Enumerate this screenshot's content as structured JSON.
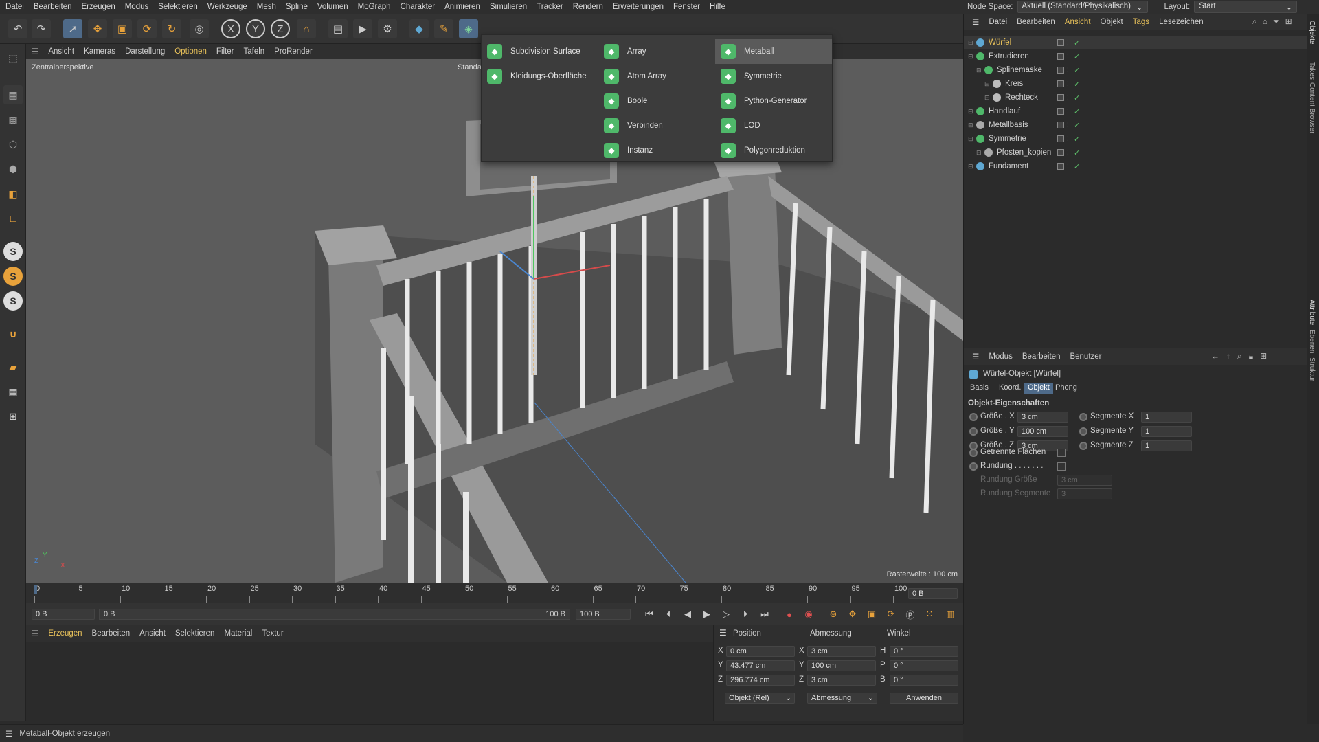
{
  "menubar": [
    "Datei",
    "Bearbeiten",
    "Erzeugen",
    "Modus",
    "Selektieren",
    "Werkzeuge",
    "Mesh",
    "Spline",
    "Volumen",
    "MoGraph",
    "Charakter",
    "Animieren",
    "Simulieren",
    "Tracker",
    "Rendern",
    "Erweiterungen",
    "Fenster",
    "Hilfe"
  ],
  "nodespace": {
    "label": "Node Space:",
    "value": "Aktuell (Standard/Physikalisch)",
    "layout_label": "Layout:",
    "layout_value": "Start"
  },
  "viewport_menu": [
    "Ansicht",
    "Kameras",
    "Darstellung",
    "Optionen",
    "Filter",
    "Tafeln",
    "ProRender"
  ],
  "viewport": {
    "title": "Zentralperspektive",
    "raster": "Rasterweite : 100 cm",
    "stand": "Standa"
  },
  "dropmenu": {
    "col1": [
      {
        "label": "Subdivision Surface",
        "color": "#4fb86a"
      },
      {
        "label": "Kleidungs-Oberfläche",
        "color": "#4fb86a"
      }
    ],
    "col2": [
      {
        "label": "Array",
        "color": "#4fb86a"
      },
      {
        "label": "Atom Array",
        "color": "#4fb86a"
      },
      {
        "label": "Boole",
        "color": "#4fb86a"
      },
      {
        "label": "Verbinden",
        "color": "#4fb86a"
      },
      {
        "label": "Instanz",
        "color": "#4fb86a"
      }
    ],
    "col3": [
      {
        "label": "Metaball",
        "color": "#4fb86a"
      },
      {
        "label": "Symmetrie",
        "color": "#4fb86a"
      },
      {
        "label": "Python-Generator",
        "color": "#4fb86a"
      },
      {
        "label": "LOD",
        "color": "#4fb86a"
      },
      {
        "label": "Polygonreduktion",
        "color": "#4fb86a"
      }
    ]
  },
  "timeline": {
    "ticks": [
      "0",
      "5",
      "10",
      "15",
      "20",
      "25",
      "30",
      "35",
      "40",
      "45",
      "50",
      "55",
      "60",
      "65",
      "70",
      "75",
      "80",
      "85",
      "90",
      "95",
      "100"
    ],
    "frame_right": "0 B"
  },
  "playbar": {
    "start": "0 B",
    "range_start": "0 B",
    "range_end": "100 B",
    "end": "100 B"
  },
  "material_menu": [
    "Erzeugen",
    "Bearbeiten",
    "Ansicht",
    "Selektieren",
    "Material",
    "Textur"
  ],
  "coords": {
    "headers": [
      "Position",
      "Abmessung",
      "Winkel"
    ],
    "rows": [
      {
        "axis": "X",
        "pos": "0 cm",
        "dimaxis": "X",
        "dim": "3 cm",
        "angaxis": "H",
        "ang": "0 °"
      },
      {
        "axis": "Y",
        "pos": "43.477 cm",
        "dimaxis": "Y",
        "dim": "100 cm",
        "angaxis": "P",
        "ang": "0 °"
      },
      {
        "axis": "Z",
        "pos": "296.774 cm",
        "dimaxis": "Z",
        "dim": "3 cm",
        "angaxis": "B",
        "ang": "0 °"
      }
    ],
    "mode": "Objekt (Rel)",
    "size": "Abmessung",
    "apply": "Anwenden"
  },
  "status": "Metaball-Objekt erzeugen",
  "objmenu": [
    "Datei",
    "Bearbeiten",
    "Ansicht",
    "Objekt",
    "Tags",
    "Lesezeichen"
  ],
  "objects": [
    {
      "name": "Würfel",
      "indent": 0,
      "color": "#5fa8d3",
      "active": true
    },
    {
      "name": "Extrudieren",
      "indent": 0,
      "color": "#4fb86a"
    },
    {
      "name": "Splinemaske",
      "indent": 1,
      "color": "#4fb86a"
    },
    {
      "name": "Kreis",
      "indent": 2,
      "color": "#bbbbbb"
    },
    {
      "name": "Rechteck",
      "indent": 2,
      "color": "#bbbbbb"
    },
    {
      "name": "Handlauf",
      "indent": 0,
      "color": "#4fb86a"
    },
    {
      "name": "Metallbasis",
      "indent": 0,
      "color": "#aaaaaa"
    },
    {
      "name": "Symmetrie",
      "indent": 0,
      "color": "#4fb86a"
    },
    {
      "name": "Pfosten_kopien",
      "indent": 1,
      "color": "#aaaaaa"
    },
    {
      "name": "Fundament",
      "indent": 0,
      "color": "#5fa8d3"
    }
  ],
  "attr": {
    "menu": [
      "Modus",
      "Bearbeiten",
      "Benutzer"
    ],
    "title": "Würfel-Objekt [Würfel]",
    "tabs": [
      "Basis",
      "Koord.",
      "Objekt",
      "Phong"
    ],
    "section": "Objekt-Eigenschaften",
    "size_rows": [
      {
        "label": "Größe . X",
        "value": "3 cm",
        "seg_label": "Segmente X",
        "seg": "1"
      },
      {
        "label": "Größe . Y",
        "value": "100 cm",
        "seg_label": "Segmente Y",
        "seg": "1"
      },
      {
        "label": "Größe . Z",
        "value": "3 cm",
        "seg_label": "Segmente Z",
        "seg": "1"
      }
    ],
    "getrennt": "Getrennte Flächen",
    "rundung": "Rundung . . . . . . .",
    "rundung_groesse": "Rundung Größe",
    "rundung_groesse_val": "3 cm",
    "rundung_segmente": "Rundung Segmente",
    "rundung_segmente_val": "3"
  },
  "sidetabs": [
    "Objekte",
    "Takes",
    "Content Browser",
    "Attribute",
    "Ebenen",
    "Struktur"
  ]
}
